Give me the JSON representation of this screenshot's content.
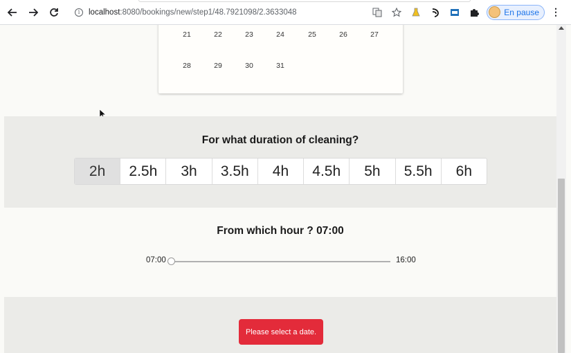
{
  "browser": {
    "url_host": "localhost",
    "url_path": ":8080/bookings/new/step1/48.7921098/2.3633048",
    "profile_label": "En pause"
  },
  "calendar": {
    "rows": [
      [
        "21",
        "22",
        "23",
        "24",
        "25",
        "26",
        "27"
      ],
      [
        "28",
        "29",
        "30",
        "31"
      ]
    ]
  },
  "duration": {
    "title": "For what duration of cleaning?",
    "options": [
      "2h",
      "2.5h",
      "3h",
      "3.5h",
      "4h",
      "4.5h",
      "5h",
      "5.5h",
      "6h"
    ],
    "selected_index": 0
  },
  "hour": {
    "title": "From which hour ? 07:00",
    "min_label": "07:00",
    "max_label": "16:00",
    "value_fraction": 0
  },
  "error_button": {
    "label": "Please select a date.",
    "color": "#e32b3a"
  }
}
